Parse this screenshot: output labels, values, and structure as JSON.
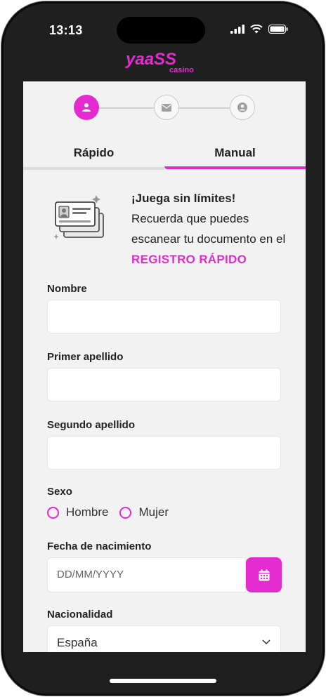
{
  "status_bar": {
    "time": "13:13"
  },
  "brand": {
    "logo_main": "yaaSS",
    "logo_sub": "casino",
    "accent_color": "#e32bd0"
  },
  "steps": [
    {
      "icon": "user-icon",
      "active": true
    },
    {
      "icon": "envelope-icon",
      "active": false
    },
    {
      "icon": "user-circle-icon",
      "active": false
    }
  ],
  "tabs": [
    {
      "label": "Rápido",
      "active": false
    },
    {
      "label": "Manual",
      "active": true
    }
  ],
  "banner": {
    "heading": "¡Juega sin límites!",
    "text": "Recuerda que puedes escanear tu documento en el",
    "link": "REGISTRO RÁPIDO"
  },
  "form": {
    "nombre_label": "Nombre",
    "nombre_value": "",
    "primer_apellido_label": "Primer apellido",
    "primer_apellido_value": "",
    "segundo_apellido_label": "Segundo apellido",
    "segundo_apellido_value": "",
    "sexo_label": "Sexo",
    "sexo_options": [
      "Hombre",
      "Mujer"
    ],
    "fecha_label": "Fecha de nacimiento",
    "fecha_placeholder": "DD/MM/YYYY",
    "nacionalidad_label": "Nacionalidad",
    "nacionalidad_value": "España"
  }
}
